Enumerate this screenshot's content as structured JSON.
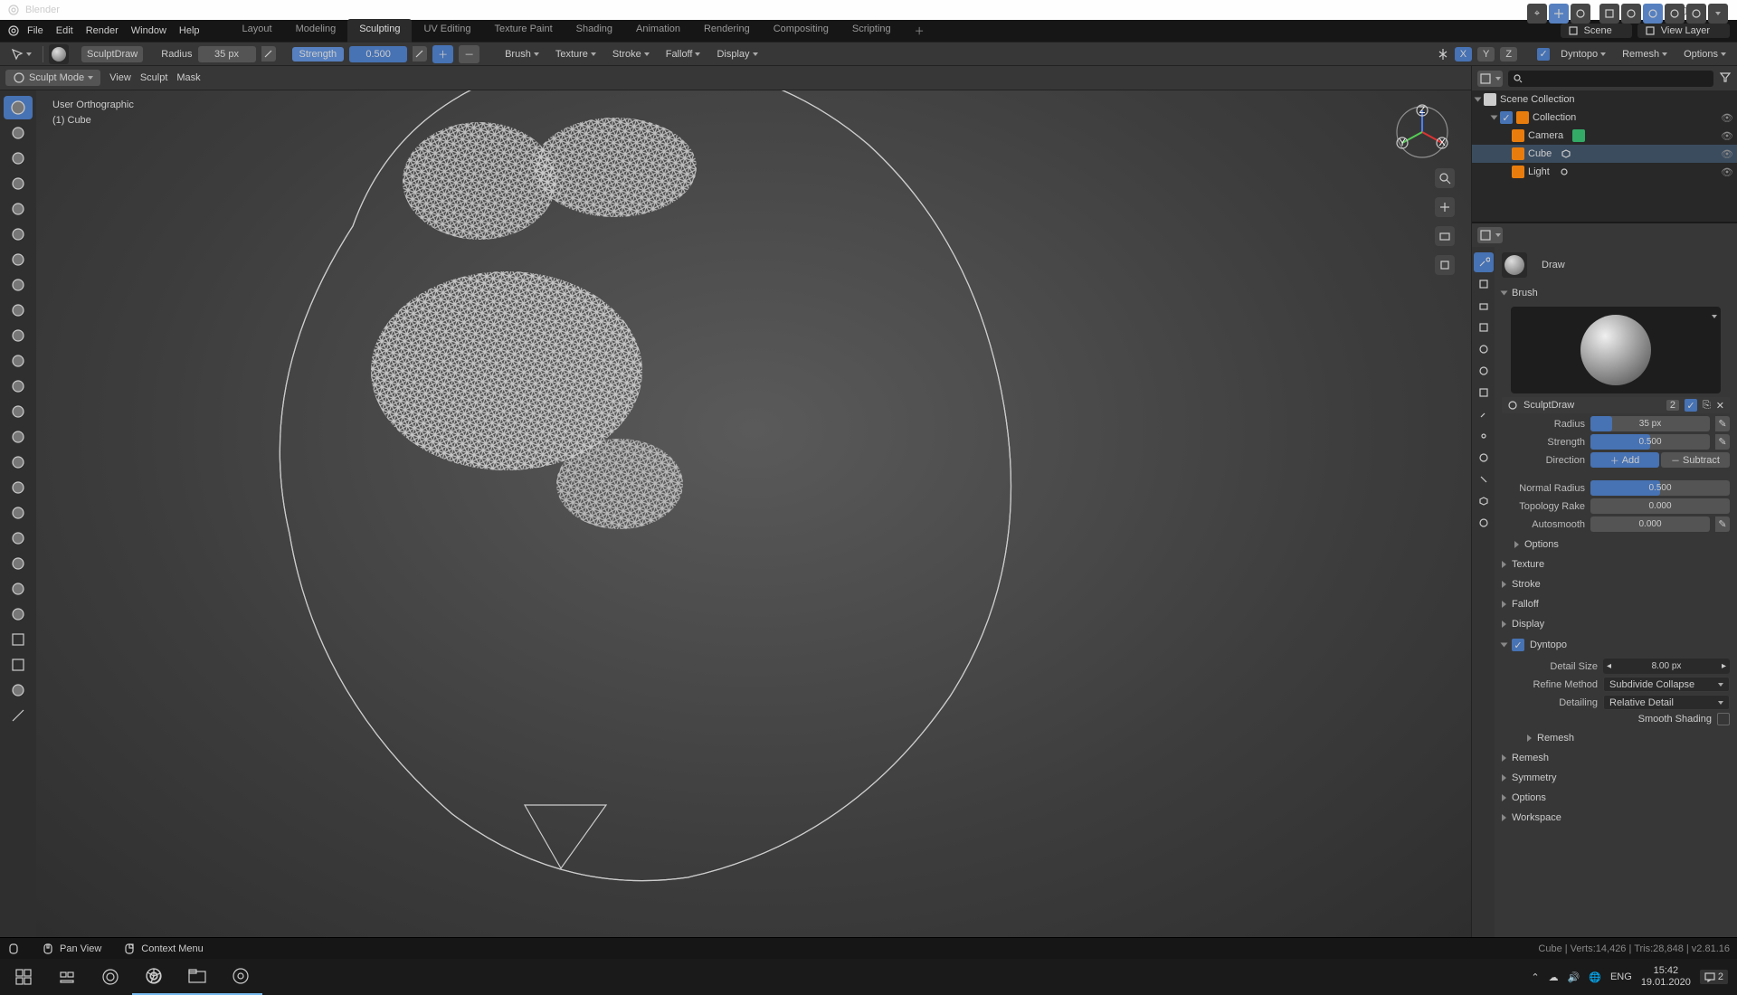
{
  "app": {
    "title": "Blender"
  },
  "menubar": [
    "File",
    "Edit",
    "Render",
    "Window",
    "Help"
  ],
  "workspaces": [
    "Layout",
    "Modeling",
    "Sculpting",
    "UV Editing",
    "Texture Paint",
    "Shading",
    "Animation",
    "Rendering",
    "Compositing",
    "Scripting"
  ],
  "workspace_active": "Sculpting",
  "scene": {
    "name": "Scene",
    "view_layer": "View Layer"
  },
  "tool_header": {
    "brush_name": "SculptDraw",
    "radius_label": "Radius",
    "radius_value": "35 px",
    "strength_label": "Strength",
    "strength_value": "0.500",
    "axes": [
      "X",
      "Y",
      "Z"
    ],
    "axes_active": "X",
    "dropdowns": [
      "Brush",
      "Texture",
      "Stroke",
      "Falloff",
      "Display"
    ],
    "right": [
      "Dyntopo",
      "Remesh",
      "Options"
    ]
  },
  "view_menu": {
    "mode": "Sculpt Mode",
    "menus": [
      "View",
      "Sculpt",
      "Mask"
    ]
  },
  "viewport_overlay": {
    "line1": "User Orthographic",
    "line2": "(1) Cube"
  },
  "outliner": {
    "root": "Scene Collection",
    "collection": "Collection",
    "items": [
      "Camera",
      "Cube",
      "Light"
    ]
  },
  "properties": {
    "context": "Draw",
    "brush_panel": "Brush",
    "brush_name": "SculptDraw",
    "brush_users": "2",
    "radius": {
      "label": "Radius",
      "value": "35 px"
    },
    "strength": {
      "label": "Strength",
      "value": "0.500"
    },
    "direction": {
      "label": "Direction",
      "add": "Add",
      "subtract": "Subtract"
    },
    "normal_radius": {
      "label": "Normal Radius",
      "value": "0.500"
    },
    "topology_rake": {
      "label": "Topology Rake",
      "value": "0.000"
    },
    "autosmooth": {
      "label": "Autosmooth",
      "value": "0.000"
    },
    "sections": [
      "Options",
      "Texture",
      "Stroke",
      "Falloff",
      "Display"
    ],
    "dyntopo": {
      "title": "Dyntopo",
      "detail_size_label": "Detail Size",
      "detail_size_value": "8.00 px",
      "refine_label": "Refine Method",
      "refine_value": "Subdivide Collapse",
      "detailing_label": "Detailing",
      "detailing_value": "Relative Detail",
      "smooth_shading": "Smooth Shading",
      "remesh_btn": "Remesh"
    },
    "bottom_sections": [
      "Remesh",
      "Symmetry",
      "Options",
      "Workspace"
    ]
  },
  "statusbar": {
    "pan": "Pan View",
    "context": "Context Menu",
    "stats": "Cube | Verts:14,426 | Tris:28,848 | v2.81.16"
  },
  "taskbar": {
    "lang": "ENG",
    "time": "15:42",
    "date": "19.01.2020",
    "notif": "2"
  }
}
